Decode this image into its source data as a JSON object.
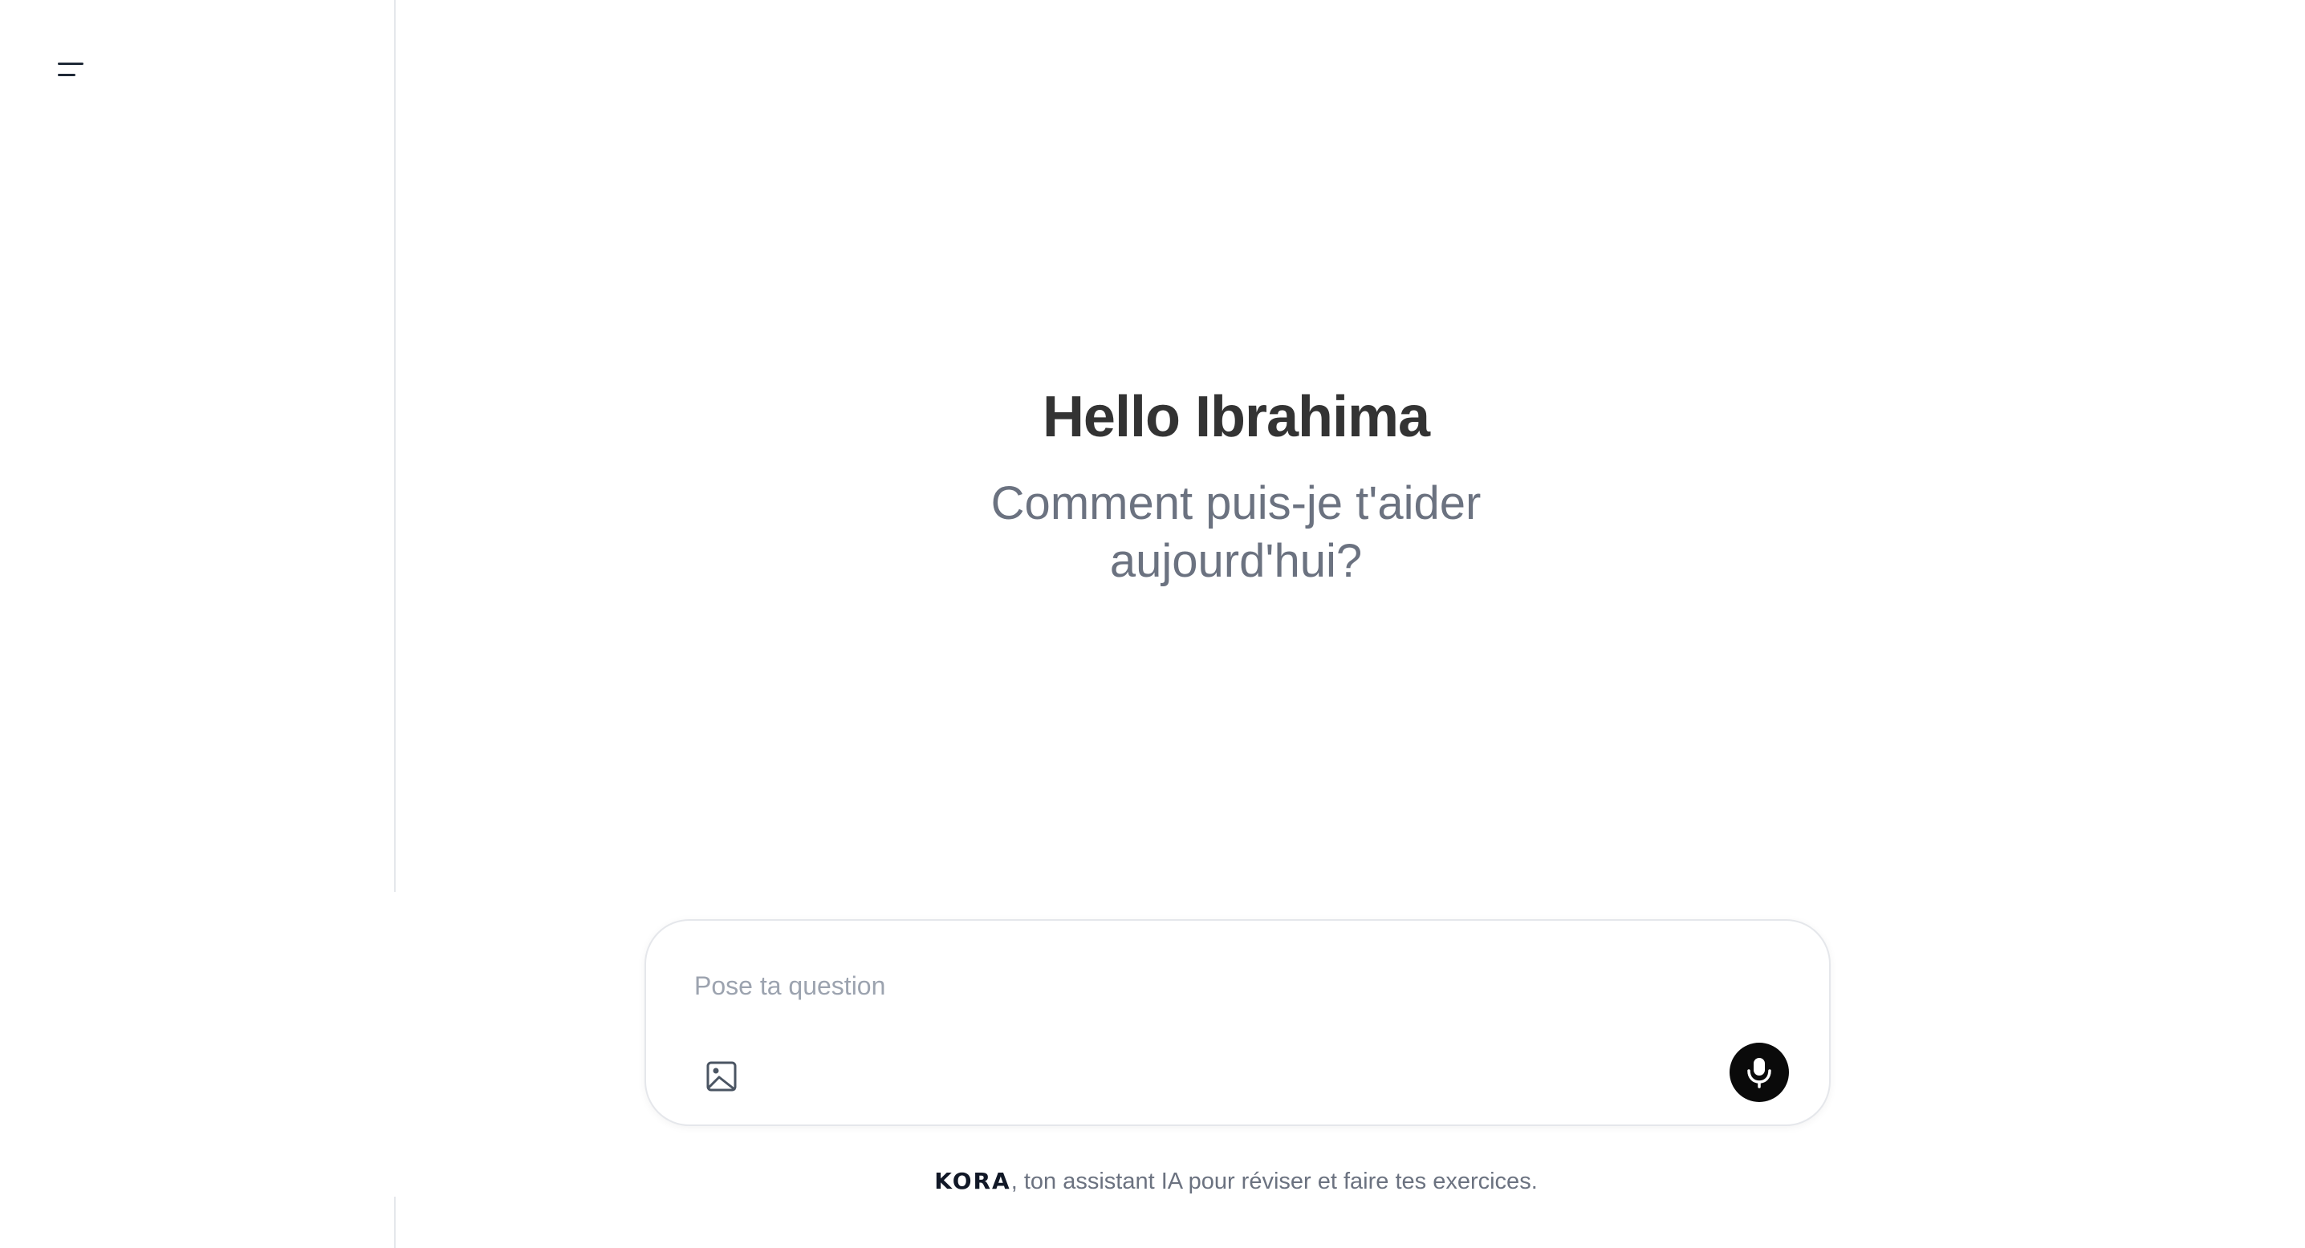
{
  "sidebar": {
    "menu_icon": "menu-lines-icon"
  },
  "main": {
    "title": "Hello Ibrahima",
    "subtitle": "Comment puis-je t'aider aujourd'hui?"
  },
  "composer": {
    "placeholder": "Pose ta question",
    "value": "",
    "image_icon": "image-icon",
    "mic_icon": "microphone-icon"
  },
  "footer": {
    "brand": "KORA",
    "tagline": ", ton assistant IA pour réviser et faire tes exercices."
  },
  "colors": {
    "mic_button_bg": "#0a0a0a",
    "title_text": "#333333",
    "subtitle_text": "#6b7280",
    "border": "#e5e7eb"
  }
}
